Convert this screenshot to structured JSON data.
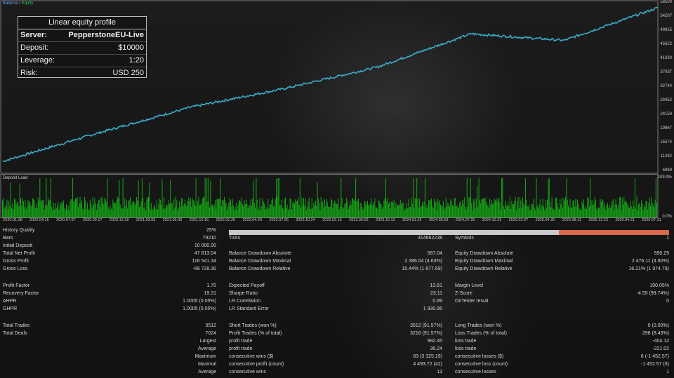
{
  "colors": {
    "balance": "#3da9d8",
    "equity": "#22c55e",
    "deposit_load": "#14a814",
    "quality_bar": "#c9c9c9",
    "quality_highlight": "#d9694a"
  },
  "legend": {
    "balance": "Balance",
    "sep": "/",
    "equity": "Equity"
  },
  "info_box": {
    "title": "Linear equity profile",
    "rows": [
      {
        "label": "Server:",
        "value": "PepperstoneEU-Live"
      },
      {
        "label": "Deposit:",
        "value": "$10000"
      },
      {
        "label": "Leverage:",
        "value": "1:20"
      },
      {
        "label": "Risk:",
        "value": "USD 250"
      }
    ]
  },
  "equity_axis": {
    "ticks": [
      "58500",
      "54207",
      "49915",
      "45622",
      "41330",
      "37037",
      "32744",
      "28452",
      "24159",
      "19867",
      "15574",
      "11282",
      "6989"
    ]
  },
  "deposit_label": "Deposit Load",
  "deposit_axis": {
    "top": "109.9%",
    "bottom": "0.0%"
  },
  "x_axis": [
    "2020.01.08",
    "2020.04.15",
    "2020.07.07",
    "2020.09.17",
    "2020.12.18",
    "2021.03.03",
    "2021.06.30",
    "2021.10.15",
    "2022.01.26",
    "2022.04.20",
    "2022.07.26",
    "2022.10.24",
    "2023.02.16",
    "2023.06.02",
    "2023.10.12",
    "2024.01.22",
    "2024.05.03",
    "2024.07.25",
    "2024.10.23",
    "2025.02.07",
    "2025.04.30",
    "2025.08.11",
    "2025.12.23",
    "2026.04.21",
    "2026.07.31"
  ],
  "chart_data": [
    {
      "type": "line",
      "legend": [
        "Balance",
        "Equity"
      ],
      "x": [
        "2020.01.08",
        "2021.01.01",
        "2022.01.01",
        "2023.01.01",
        "2024.01.22",
        "2025.01.01",
        "2025.06.01",
        "2026.07.31"
      ],
      "series": [
        {
          "name": "Balance",
          "values": [
            10000,
            18500,
            26500,
            32200,
            38800,
            49000,
            47000,
            57000
          ]
        },
        {
          "name": "Equity",
          "values": [
            10000,
            18500,
            26500,
            32200,
            38800,
            49000,
            47000,
            57000
          ]
        }
      ],
      "ylim": [
        6989,
        58500
      ],
      "y_ticks": [
        6989,
        11282,
        15574,
        19867,
        24159,
        28452,
        32744,
        37037,
        41330,
        45622,
        49915,
        54207,
        58500
      ]
    },
    {
      "type": "bar",
      "title": "Deposit Load",
      "ylim": [
        0,
        109.9
      ],
      "unit": "%"
    }
  ],
  "stats": {
    "history_quality": {
      "label": "History Quality",
      "value": "25%",
      "fraction": 0.25
    },
    "bars": {
      "label": "Bars",
      "value": "79210"
    },
    "ticks": {
      "label": "Ticks",
      "value": "314662238"
    },
    "symbols": {
      "label": "Symbols",
      "value": "1"
    },
    "initial_deposit": {
      "label": "Initial Deposit",
      "value": "10 000.00"
    },
    "total_net_profit": {
      "label": "Total Net Profit",
      "value": "47 813.04"
    },
    "gross_profit": {
      "label": "Gross Profit",
      "value": "116 541.34"
    },
    "gross_loss": {
      "label": "Gross Loss",
      "value": "-68 728.30"
    },
    "bal_dd_abs": {
      "label": "Balance Drawdown Absolute",
      "value": "587.04"
    },
    "bal_dd_max": {
      "label": "Balance Drawdown Maximal",
      "value": "2 386.04 (4.63%)"
    },
    "bal_dd_rel": {
      "label": "Balance Drawdown Relative",
      "value": "15.44% (1 877.69)"
    },
    "eq_dd_abs": {
      "label": "Equity Drawdown Absolute",
      "value": "590.29"
    },
    "eq_dd_max": {
      "label": "Equity Drawdown Maximal",
      "value": "2 476.11 (4.80%)"
    },
    "eq_dd_rel": {
      "label": "Equity Drawdown Relative",
      "value": "16.21% (1 974.79)"
    },
    "profit_factor": {
      "label": "Profit Factor",
      "value": "1.70"
    },
    "recovery_factor": {
      "label": "Recovery Factor",
      "value": "19.31"
    },
    "ahpr": {
      "label": "AHPR",
      "value": "1.0005 (0.05%)"
    },
    "ghpr": {
      "label": "GHPR",
      "value": "1.0005 (0.05%)"
    },
    "expected_payoff": {
      "label": "Expected Payoff",
      "value": "13.61"
    },
    "sharpe": {
      "label": "Sharpe Ratio",
      "value": "23.11"
    },
    "lr_corr": {
      "label": "LR Correlation",
      "value": "0.99"
    },
    "lr_err": {
      "label": "LR Standard Error",
      "value": "1 930.95"
    },
    "margin_level": {
      "label": "Margin Level",
      "value": "100.05%"
    },
    "z_score": {
      "label": "Z-Score",
      "value": "-4.55 (99.74%)"
    },
    "on_tester": {
      "label": "OnTester result",
      "value": "0"
    },
    "total_trades": {
      "label": "Total Trades",
      "value": "3512"
    },
    "total_deals": {
      "label": "Total Deals",
      "value": "7024"
    },
    "short_trades": {
      "label": "Short Trades (won %)",
      "value": "3512 (91.57%)"
    },
    "profit_trades": {
      "label": "Profit Trades (% of total)",
      "value": "3216 (91.57%)"
    },
    "long_trades": {
      "label": "Long Trades (won %)",
      "value": "0 (0.00%)"
    },
    "loss_trades": {
      "label": "Loss Trades (% of total)",
      "value": "296 (8.43%)"
    },
    "largest": {
      "label": "Largest",
      "mid": "profit trade",
      "mid_value": "992.45",
      "right": "loss trade",
      "right_value": "-404.12"
    },
    "average": {
      "label": "Average",
      "mid": "profit trade",
      "mid_value": "36.24",
      "right": "loss trade",
      "right_value": "-221.02"
    },
    "maximum": {
      "label": "Maximum",
      "mid": "consecutive wins ($)",
      "mid_value": "83 (3 325.19)",
      "right": "consecutive losses ($)",
      "right_value": "6 (-1 452.57)"
    },
    "maximal": {
      "label": "Maximal",
      "mid": "consecutive profit (count)",
      "mid_value": "4 493.72 (42)",
      "right": "consecutive loss (count)",
      "right_value": "-1 452.57 (6)"
    },
    "average2": {
      "label": "Average",
      "mid": "consecutive wins",
      "mid_value": "13",
      "right": "consecutive losses",
      "right_value": "1"
    }
  }
}
